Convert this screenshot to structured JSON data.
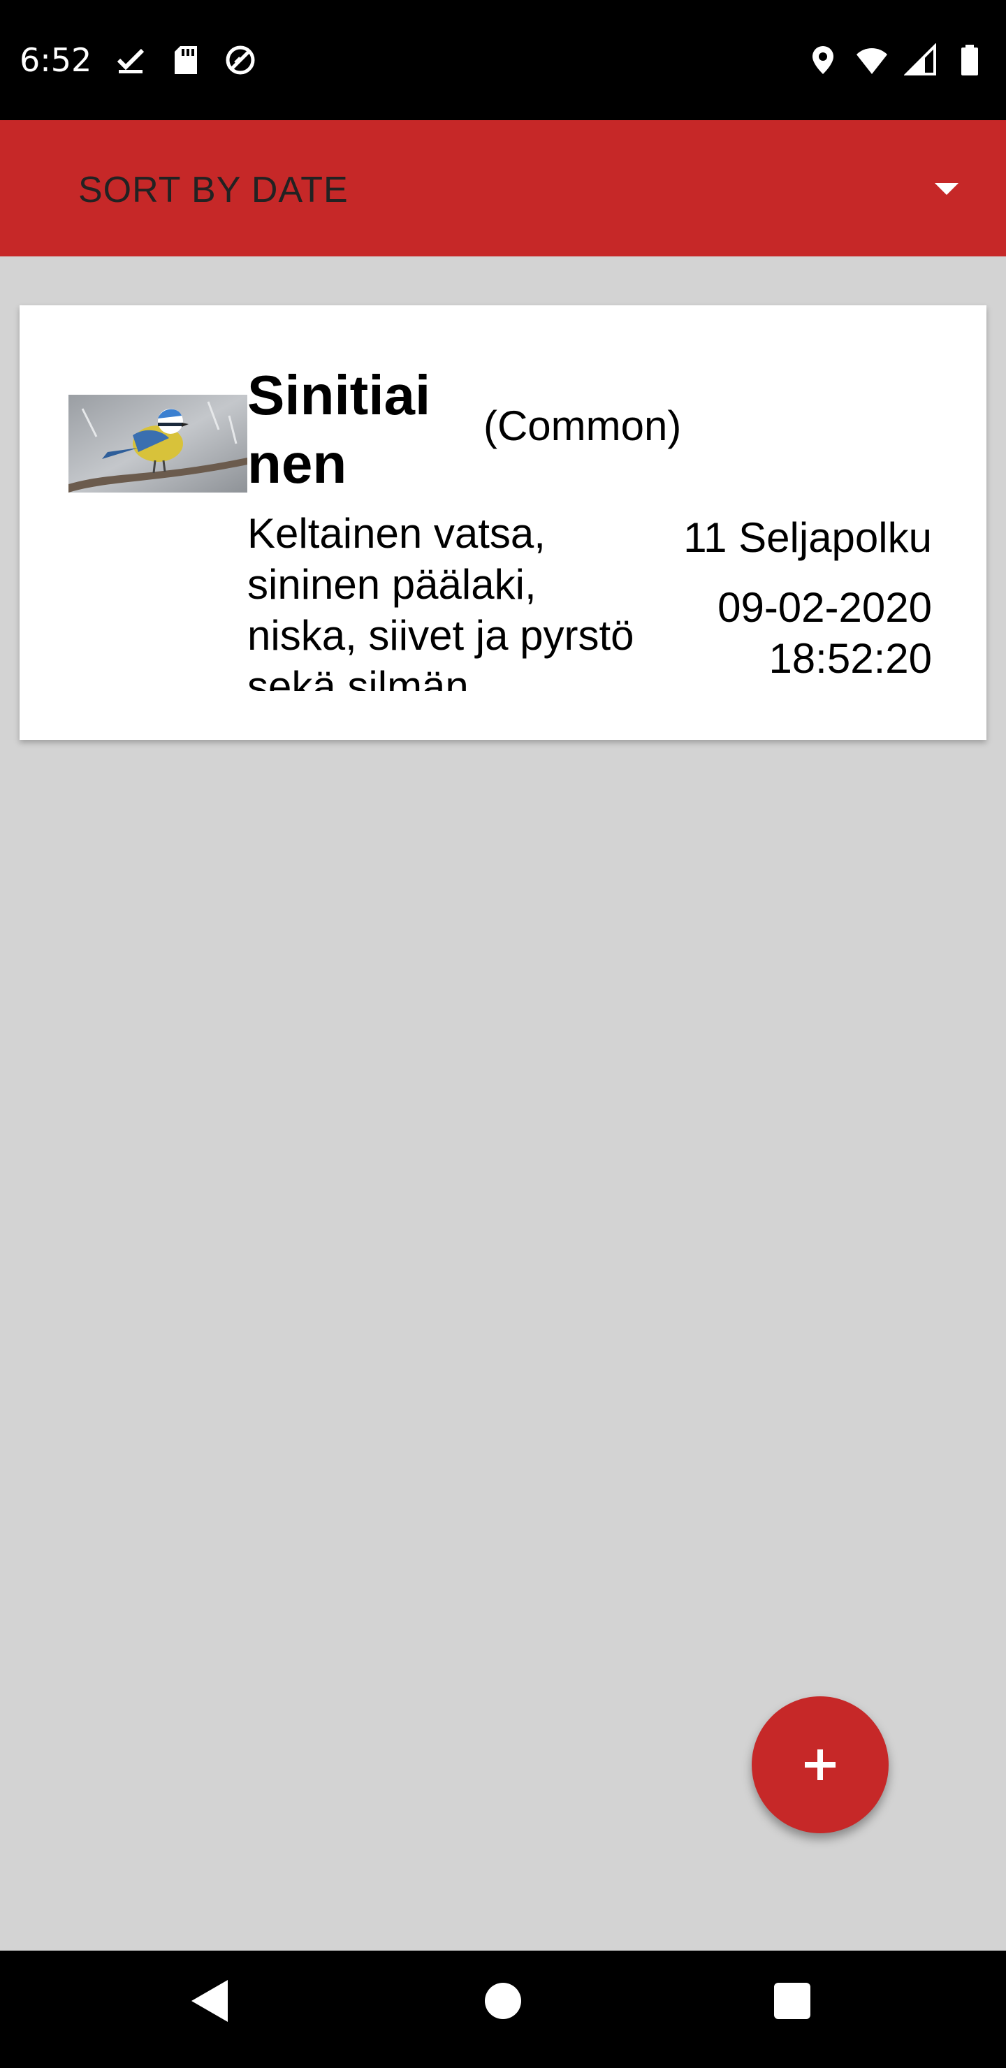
{
  "status_bar": {
    "time": "6:52",
    "left_icons": [
      "task-check-icon",
      "sd-card-icon",
      "data-saver-icon"
    ],
    "right_icons": [
      "location-icon",
      "wifi-icon",
      "signal-icon",
      "battery-icon"
    ]
  },
  "toolbar": {
    "sort_label": "SORT BY DATE",
    "accent_color": "#c62828"
  },
  "observations": [
    {
      "name": "Sinitiainen",
      "rarity": "(Common)",
      "notes": "Keltainen vatsa, sininen päälaki, niska, siivet ja pyrstö sekä silmän",
      "location": "11 Seljapolku",
      "datetime": "09-02-2020 18:52:20",
      "image": "blue-tit-photo"
    }
  ],
  "fab": {
    "icon": "plus-icon"
  },
  "nav_bar": {
    "icons": [
      "back-icon",
      "home-icon",
      "recents-icon"
    ]
  }
}
